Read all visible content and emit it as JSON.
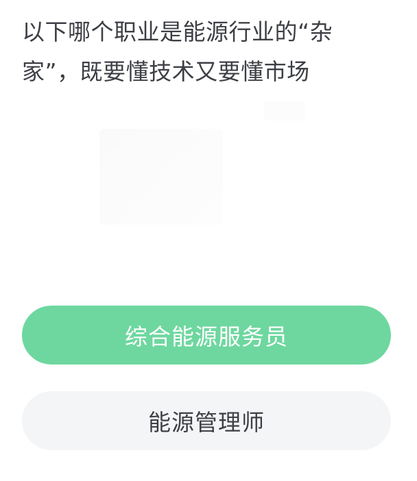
{
  "question": {
    "text": "以下哪个职业是能源行业的“杂家”，既要懂技术又要懂市场"
  },
  "options": [
    {
      "label": "综合能源服务员",
      "state": "highlighted",
      "color": "#6ed79f"
    },
    {
      "label": "能源管理师",
      "state": "default",
      "color": "#f4f5f7"
    }
  ],
  "colors": {
    "text": "#3d3f45",
    "accent": "#6ed79f",
    "option_bg": "#f4f5f7"
  }
}
